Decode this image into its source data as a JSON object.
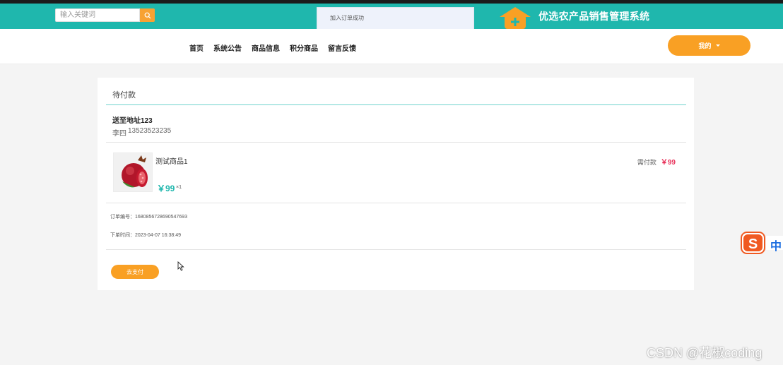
{
  "header": {
    "search": {
      "placeholder": "输入关键词",
      "value": ""
    },
    "search_icon": "search-icon",
    "toast": "加入订单成功",
    "site_title": "优选农产品销售管理系统",
    "logo_icon": "house-plus-icon",
    "colors": {
      "teal": "#1fb7ad",
      "orange": "#f9a024"
    }
  },
  "nav": {
    "items": [
      {
        "label": "首页"
      },
      {
        "label": "系统公告"
      },
      {
        "label": "商品信息"
      },
      {
        "label": "积分商品"
      },
      {
        "label": "留言反馈"
      }
    ],
    "mine_label": "我的"
  },
  "order": {
    "status": "待付款",
    "address": "送至地址123",
    "recipient": "李四",
    "phone": "13523523235",
    "product": {
      "name": "测试商品1",
      "price": "￥99",
      "qty": "×1",
      "image_icon": "pomegranate-image"
    },
    "due_label": "需付款",
    "due_amount": "￥99",
    "order_no": "订单编号：1680856728690547693",
    "order_time": "下单时间：2023-04-07 16:38:49",
    "pay_label": "去支付",
    "price_color": "#e8325a"
  },
  "overlay": {
    "ime_label": "中",
    "watermark": "CSDN @花椒coding"
  }
}
